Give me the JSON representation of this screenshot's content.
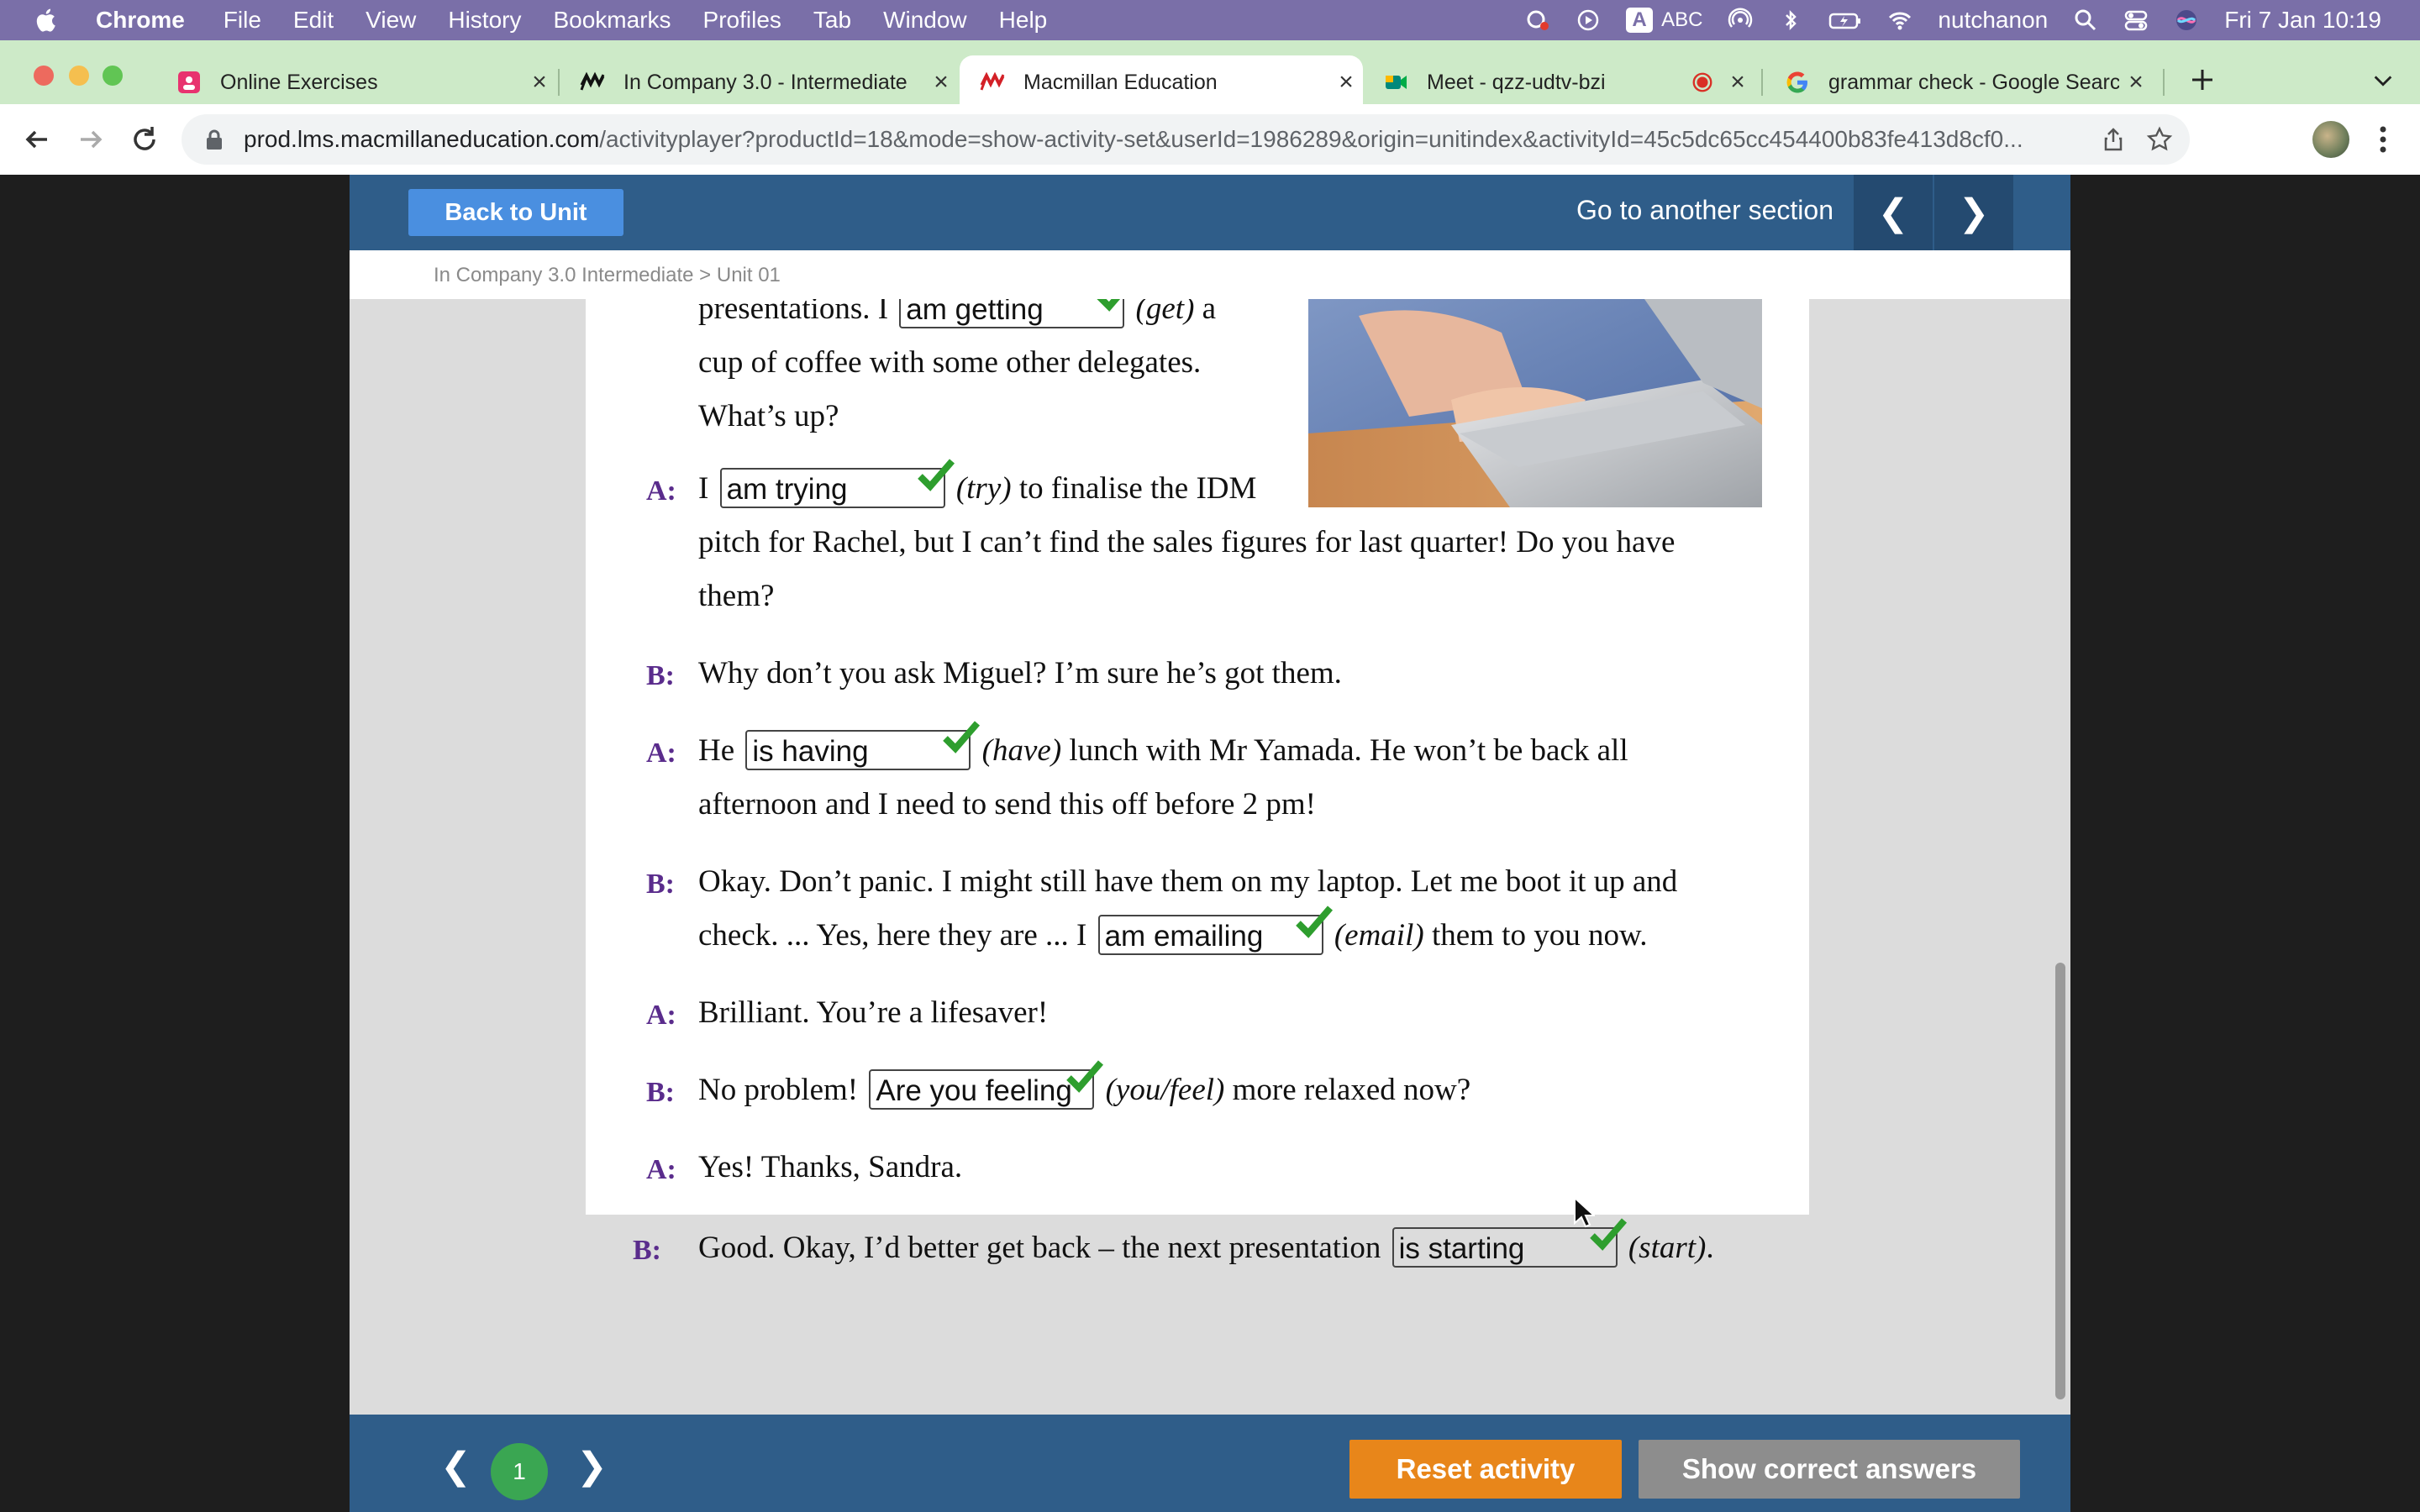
{
  "menubar": {
    "app": "Chrome",
    "items": [
      "File",
      "Edit",
      "View",
      "History",
      "Bookmarks",
      "Profiles",
      "Tab",
      "Window",
      "Help"
    ],
    "input_source": "ABC",
    "user": "nutchanon",
    "datetime": "Fri 7 Jan  10:19"
  },
  "tabs": [
    {
      "title": "Online Exercises",
      "icon": "pink-app-icon"
    },
    {
      "title": "In Company 3.0 - Intermediate",
      "icon": "macmillan-icon"
    },
    {
      "title": "Macmillan Education",
      "icon": "macmillan-icon",
      "active": true
    },
    {
      "title": "Meet - qzz-udtv-bzi",
      "icon": "google-meet-icon"
    },
    {
      "title": "grammar check - Google Search",
      "icon": "google-icon"
    }
  ],
  "address": {
    "domain": "prod.lms.macmillaneducation.com",
    "path": "/activityplayer?productId=18&mode=show-activity-set&userId=1986289&origin=unitindex&activityId=45c5dc65cc454400b83fe413d8cf0..."
  },
  "lms": {
    "back_label": "Back to Unit",
    "section_label": "Go to another section",
    "prev_glyph": "❮",
    "next_glyph": "❯",
    "breadcrumb": "In Company 3.0 Intermediate  >  Unit 01"
  },
  "dialogue": {
    "l1_pre": "presentations. I",
    "l1_gap": "am getting",
    "l1_post": "(get) a",
    "l2": "cup of coffee with some other delegates.",
    "l3": "What’s up?",
    "a1_speaker": "A:",
    "a1_pre": "I",
    "a1_gap": "am trying",
    "a1_post": "(try) to finalise the IDM",
    "a1_l2": "pitch for Rachel, but I can’t find the sales figures for last quarter! Do you have",
    "a1_l3": "them?",
    "b1_speaker": "B:",
    "b1_text": "Why don’t you ask Miguel? I’m sure he’s got them.",
    "a2_speaker": "A:",
    "a2_pre": "He",
    "a2_gap": "is having",
    "a2_post": "(have) lunch with Mr Yamada. He won’t be back all",
    "a2_l2": "afternoon and I need to send this off before 2 pm!",
    "b2_speaker": "B:",
    "b2_l1": "Okay. Don’t panic. I might still have them on my laptop. Let me boot it up and",
    "b2_pre": "check. ... Yes, here they are ... I",
    "b2_gap": "am emailing",
    "b2_post": "(email) them to you now.",
    "a3_speaker": "A:",
    "a3_text": "Brilliant. You’re a lifesaver!",
    "b3_speaker": "B:",
    "b3_pre": "No problem!",
    "b3_gap": "Are you feeling",
    "b3_post": "(you/feel) more relaxed now?",
    "a4_speaker": "A:",
    "a4_text": "Yes! Thanks, Sandra.",
    "b4_speaker": "B:",
    "b4_pre": "Good. Okay, I’d better get back – the next presentation",
    "b4_gap": "is starting",
    "b4_post": "(start)."
  },
  "footer": {
    "page": "1",
    "prev_glyph": "❮",
    "next_glyph": "❯",
    "reset_label": "Reset activity",
    "show_label": "Show correct answers"
  },
  "colors": {
    "menubar": "#7a6fa8",
    "tabbar": "#cdeac8",
    "lms_header": "#2f5d89",
    "back_button": "#4a8fe0",
    "speaker": "#5a2c8c",
    "check": "#2e9e2e",
    "reset": "#e8861a",
    "show": "#8d8d8d",
    "page_badge": "#3aa652"
  }
}
